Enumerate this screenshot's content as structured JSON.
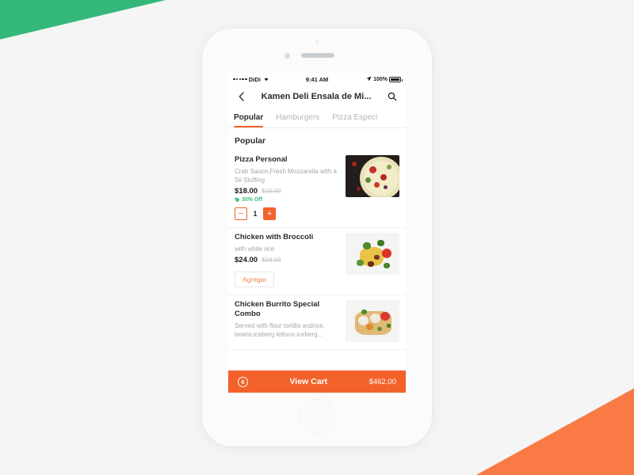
{
  "decor": {
    "top_left_color": "#33b87a",
    "bottom_right_color": "#fa7a46",
    "background_color": "#f5f5f5"
  },
  "theme": {
    "accent": "#f2622a",
    "accent_light": "#f2824e",
    "discount_green": "#3fc07f",
    "text_dark": "#2b2b2b",
    "text_muted": "#a6a6a6"
  },
  "status_bar": {
    "carrier": "DiDi",
    "signal_dots": 5,
    "wifi_icon": "wifi-icon",
    "time": "9:41 AM",
    "battery_percent": "100%",
    "location_icon": "location-arrow-icon"
  },
  "header": {
    "back_icon": "chevron-left-icon",
    "title": "Kamen Deli Ensala de Mi...",
    "search_icon": "search-icon"
  },
  "tabs": [
    {
      "label": "Popular",
      "active": true
    },
    {
      "label": "Hamburgers",
      "active": false
    },
    {
      "label": "Pizza Especi",
      "active": false
    }
  ],
  "main": {
    "section_title": "Popular",
    "items": [
      {
        "name": "Pizza Personal",
        "description": "Crab Sauce,Fresh Mozzarella with a Sii Stuffing",
        "price": "$18.00",
        "price_old": "$16.00",
        "discount": "30% Off",
        "discount_icon": "tag-icon",
        "control": "stepper",
        "quantity": "1",
        "minus_label": "−",
        "plus_label": "+",
        "thumb": "pizza-personal-photo"
      },
      {
        "name": "Chicken with Broccoli",
        "description": "with white rice",
        "price": "$24.00",
        "price_old": "$18.00",
        "discount": null,
        "control": "button",
        "button_label": "Agregar",
        "thumb": "chicken-broccoli-photo"
      },
      {
        "name": "Chicken Burrito Special Combo",
        "description": "Served with flour tortilla andrice, beans,iceberg lettuce iceberg...",
        "price": null,
        "price_old": null,
        "discount": null,
        "control": "none",
        "thumb": "chicken-burrito-photo"
      }
    ]
  },
  "cart_bar": {
    "count": "6",
    "label": "View Cart",
    "total": "$462,00"
  }
}
